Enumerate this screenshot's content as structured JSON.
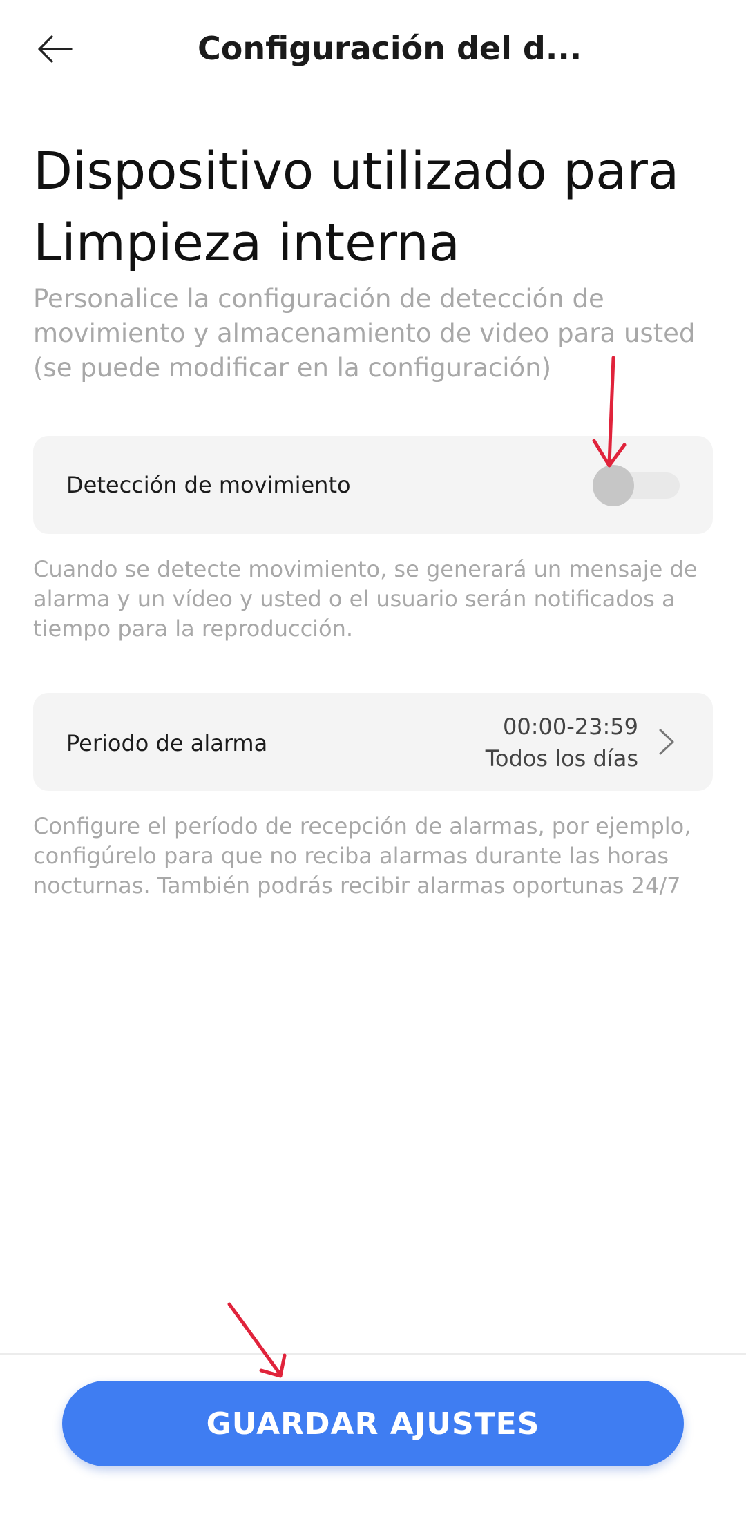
{
  "header": {
    "back_icon": "arrow-left-icon",
    "title": "Configuración del d..."
  },
  "heading": "Dispositivo utilizado para Limpieza interna",
  "subtitle": "Personalice la configuración de detección de movimiento y almacenamiento de video para usted (se puede modificar en la configuración)",
  "motion_detection": {
    "label": "Detección de movimiento",
    "enabled": false,
    "help": "Cuando se detecte movimiento, se generará un mensaje de alarma y un vídeo y usted o el usuario serán notificados a tiempo para la reproducción."
  },
  "alarm_period": {
    "label": "Periodo de alarma",
    "time_range": "00:00-23:59",
    "days": "Todos los días",
    "chevron_icon": "chevron-right-icon",
    "help": "Configure el período de recepción de alarmas, por ejemplo, configúrelo para que no reciba alarmas durante las horas nocturnas. También podrás recibir alarmas oportunas 24/7"
  },
  "footer": {
    "save_label": "GUARDAR AJUSTES"
  },
  "colors": {
    "accent": "#3f7df2",
    "annotation_arrow": "#e0233b",
    "muted_text": "#a8a8a8",
    "card_background": "#f4f4f4"
  }
}
